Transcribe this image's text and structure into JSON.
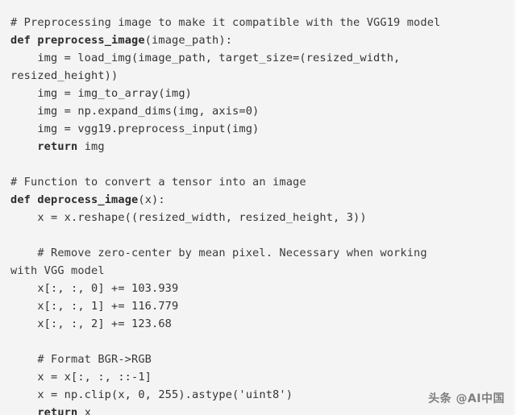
{
  "document": {
    "type": "code-listing",
    "language": "python",
    "background_color": "#f4f4f4",
    "text_color": "#333333",
    "lines": [
      {
        "id": "line-1",
        "kind": "comment",
        "text": "# Preprocessing image to make it compatible with the VGG19 model"
      },
      {
        "id": "line-2",
        "kind": "code",
        "keyword": "def",
        "name": "preprocess_image",
        "rest": "(image_path):"
      },
      {
        "id": "line-3",
        "kind": "code",
        "text": "    img = load_img(image_path, target_size=(resized_width,"
      },
      {
        "id": "line-4",
        "kind": "code",
        "text": "resized_height))"
      },
      {
        "id": "line-5",
        "kind": "code",
        "text": "    img = img_to_array(img)"
      },
      {
        "id": "line-6",
        "kind": "code",
        "text": "    img = np.expand_dims(img, axis=0)"
      },
      {
        "id": "line-7",
        "kind": "code",
        "text": "    img = vgg19.preprocess_input(img)"
      },
      {
        "id": "line-8",
        "kind": "code",
        "indent": "    ",
        "keyword": "return",
        "rest": " img"
      },
      {
        "id": "line-9",
        "kind": "blank",
        "text": ""
      },
      {
        "id": "line-10",
        "kind": "comment",
        "text": "# Function to convert a tensor into an image"
      },
      {
        "id": "line-11",
        "kind": "code",
        "keyword": "def",
        "name": "deprocess_image",
        "rest": "(x):"
      },
      {
        "id": "line-12",
        "kind": "code",
        "text": "    x = x.reshape((resized_width, resized_height, 3))"
      },
      {
        "id": "line-13",
        "kind": "blank",
        "text": ""
      },
      {
        "id": "line-14",
        "kind": "comment",
        "text": "    # Remove zero-center by mean pixel. Necessary when working"
      },
      {
        "id": "line-15",
        "kind": "comment",
        "text": "with VGG model"
      },
      {
        "id": "line-16",
        "kind": "code",
        "text": "    x[:, :, 0] += 103.939"
      },
      {
        "id": "line-17",
        "kind": "code",
        "text": "    x[:, :, 1] += 116.779"
      },
      {
        "id": "line-18",
        "kind": "code",
        "text": "    x[:, :, 2] += 123.68"
      },
      {
        "id": "line-19",
        "kind": "blank",
        "text": ""
      },
      {
        "id": "line-20",
        "kind": "comment",
        "text": "    # Format BGR->RGB"
      },
      {
        "id": "line-21",
        "kind": "code",
        "text": "    x = x[:, :, ::-1]"
      },
      {
        "id": "line-22",
        "kind": "code",
        "text": "    x = np.clip(x, 0, 255).astype('uint8')"
      },
      {
        "id": "line-23",
        "kind": "code",
        "indent": "    ",
        "keyword": "return",
        "rest": " x"
      }
    ]
  },
  "watermark": {
    "text": "头条 @AI中国"
  }
}
